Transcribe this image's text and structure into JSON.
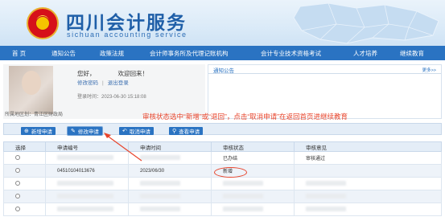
{
  "header": {
    "title": "四川会计服务",
    "subtitle": "sichuan accounting service"
  },
  "nav": {
    "items": [
      "首 页",
      "通知公告",
      "政策法规",
      "会计师事务所及代理记账机构",
      "会计专业技术资格考试",
      "人才培养",
      "继续教育"
    ]
  },
  "user": {
    "greeting": "您好，",
    "welcome": "欢迎回来！",
    "change_password": "修改密码",
    "separator": "|",
    "logout": "退出登录",
    "login_time": "登录时间：2023-06-30 15:18:08",
    "region": "所属地区划：青江区财政局"
  },
  "notice": {
    "tab": "通知公告",
    "more": "更多>>"
  },
  "annotation": "审核状态选中“新增”或“退回”，点击“取消申请”在返回首页进继续教育",
  "toolbar": {
    "add": "新增申请",
    "edit": "修改申请",
    "cancel": "取消申请",
    "query": "查看申请"
  },
  "table": {
    "headers": [
      "选择",
      "申请编号",
      "申请时间",
      "审核状态",
      "审核意见"
    ],
    "rows": [
      {
        "id": "",
        "time": "",
        "status": "已办结",
        "opinion": "审核通过"
      },
      {
        "id": "04510104013676",
        "time": "2023/06/30",
        "status": "新增",
        "opinion": ""
      },
      {
        "id": "",
        "time": "",
        "status": "",
        "opinion": ""
      },
      {
        "id": "",
        "time": "",
        "status": "",
        "opinion": ""
      },
      {
        "id": "",
        "time": "",
        "status": "",
        "opinion": ""
      }
    ]
  },
  "colors": {
    "nav_bg": "#2a73c2",
    "annotation": "#e8442b",
    "title": "#1f5fa8"
  }
}
